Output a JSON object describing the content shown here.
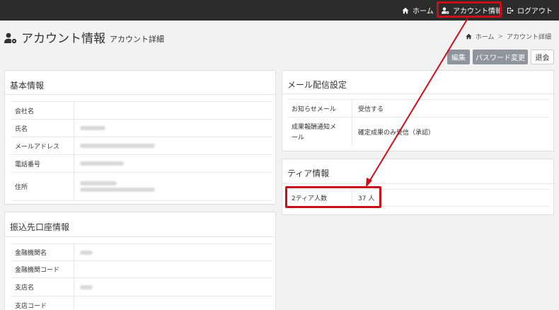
{
  "nav": {
    "home_label": "ホーム",
    "account_label": "アカウント情報",
    "logout_label": "ログアウト"
  },
  "header": {
    "title": "アカウント情報",
    "subtitle": "アカウント詳細"
  },
  "breadcrumb": {
    "home": "ホーム",
    "separator": ">",
    "current": "アカウント詳細"
  },
  "actions": {
    "edit": "編集",
    "password_change": "パスワード変更",
    "withdraw": "退会"
  },
  "basic_info": {
    "title": "基本情報",
    "rows": [
      {
        "label": "会社名",
        "value": ""
      },
      {
        "label": "氏名",
        "value": ""
      },
      {
        "label": "メールアドレス",
        "value": ""
      },
      {
        "label": "電話番号",
        "value": ""
      },
      {
        "label": "住所",
        "value": ""
      }
    ]
  },
  "bank_info": {
    "title": "振込先口座情報",
    "rows": [
      {
        "label": "金融機関名",
        "value": ""
      },
      {
        "label": "金融機関コード",
        "value": ""
      },
      {
        "label": "支店名",
        "value": ""
      },
      {
        "label": "支店コード",
        "value": ""
      }
    ]
  },
  "mail_settings": {
    "title": "メール配信設定",
    "rows": [
      {
        "label": "お知らせメール",
        "value": "受信する"
      },
      {
        "label_line1": "成果報酬通知メ",
        "label_line2": "ール",
        "value": "確定成果のみ受信（承認）"
      }
    ]
  },
  "tier_info": {
    "title": "ティア情報",
    "rows": [
      {
        "label": "2ティア人数",
        "value": "37 人"
      }
    ]
  },
  "colors": {
    "navbar_bg": "#2c2c2c",
    "highlight_red": "#c8101a",
    "button_gray": "#8e959d"
  },
  "icons": {
    "nav_home": "home-icon",
    "nav_account": "user-gear-icon",
    "nav_logout": "logout-icon",
    "title": "user-gear-icon"
  }
}
